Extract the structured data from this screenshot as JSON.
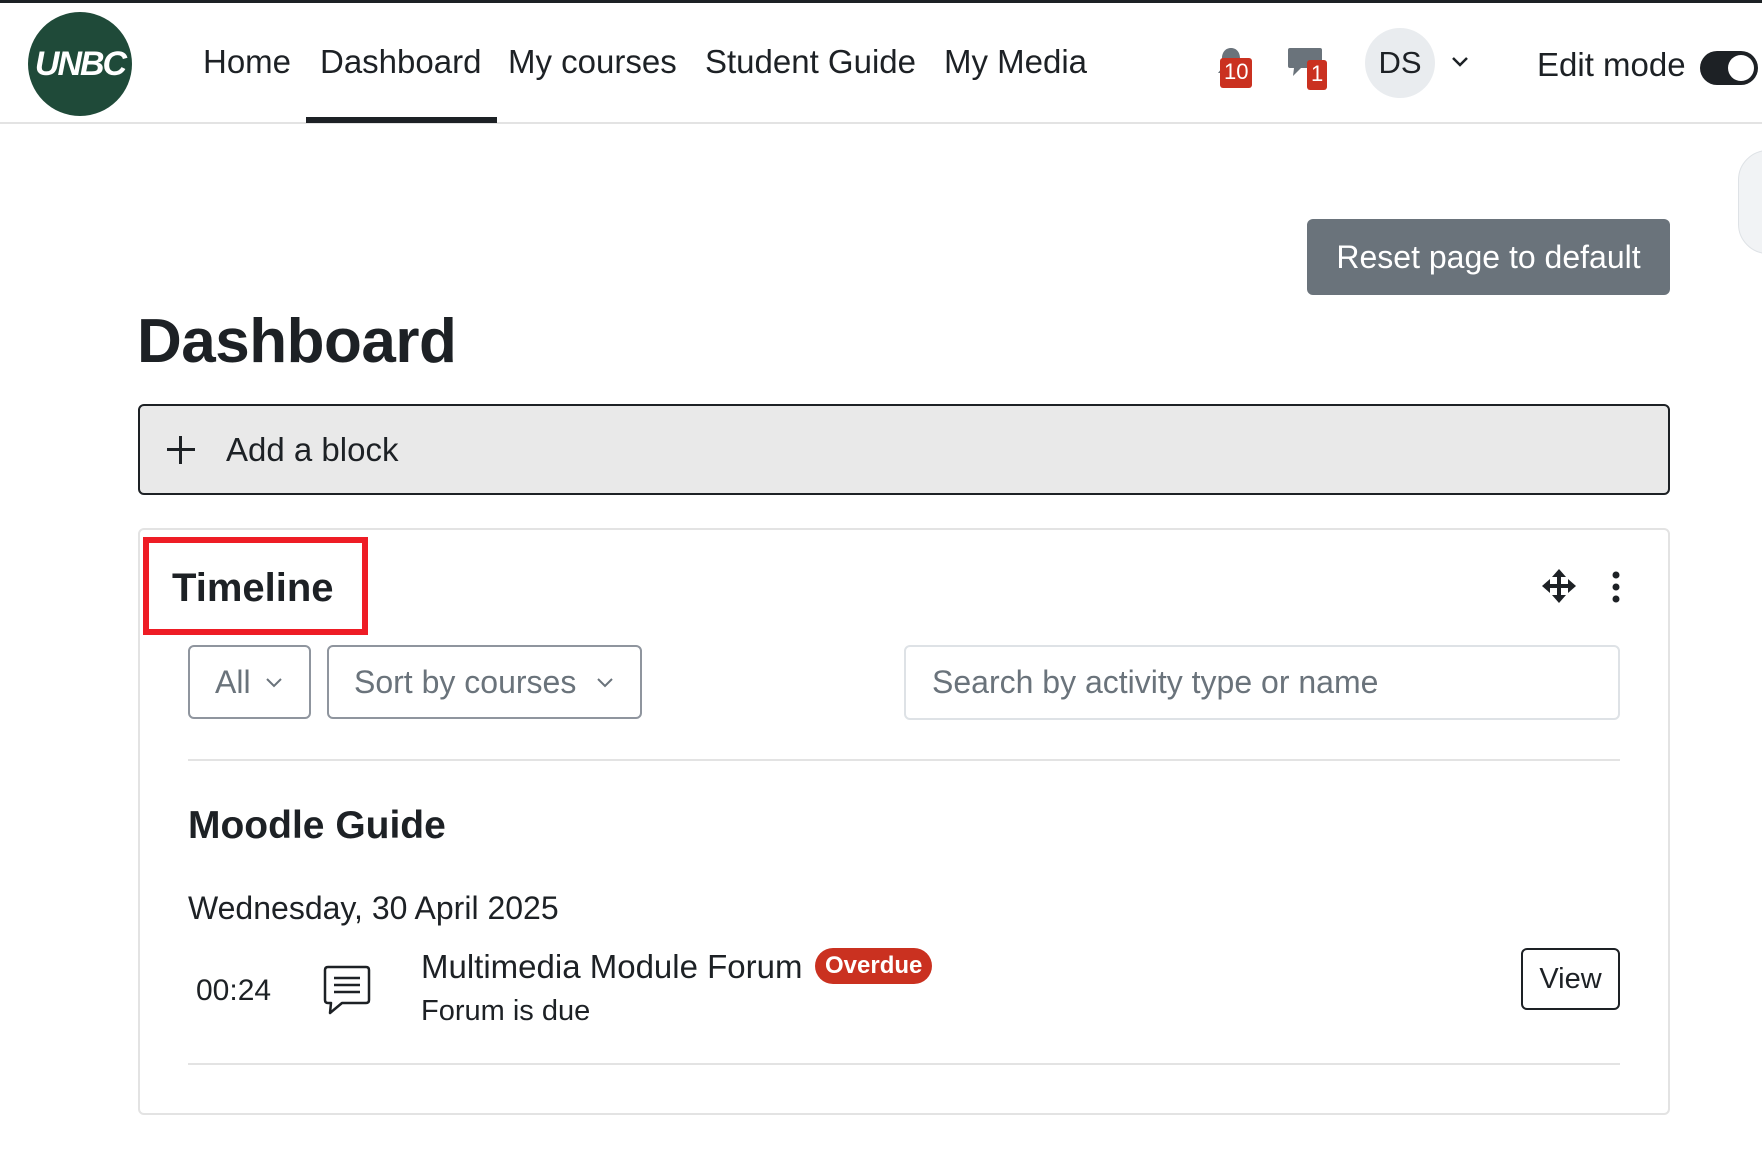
{
  "brand": {
    "logo_text": "UNBC",
    "logo_color": "#1f4a39"
  },
  "nav": {
    "links": [
      "Home",
      "Dashboard",
      "My courses",
      "Student Guide",
      "My Media"
    ],
    "active": "Dashboard"
  },
  "notifications": {
    "count": "10",
    "icon": "bell-icon"
  },
  "messages": {
    "count": "1",
    "icon": "chat-icon"
  },
  "user": {
    "initials": "DS"
  },
  "edit_mode": {
    "label": "Edit mode",
    "enabled": true
  },
  "page": {
    "reset_button": "Reset page to default",
    "title": "Dashboard",
    "add_block": "Add a block"
  },
  "timeline": {
    "title": "Timeline",
    "filter_value": "All",
    "sort_value": "Sort by courses",
    "search_placeholder": "Search by activity type or name",
    "course": {
      "name": "Moodle Guide",
      "date": "Wednesday, 30 April 2025",
      "event": {
        "time": "00:24",
        "name": "Multimedia Module Forum",
        "badge": "Overdue",
        "subtitle": "Forum is due",
        "action": "View"
      }
    }
  },
  "colors": {
    "accent": "#1d2125",
    "danger": "#ca3120",
    "secondary_button": "#6a737b",
    "highlight_box": "#ee1c25"
  }
}
